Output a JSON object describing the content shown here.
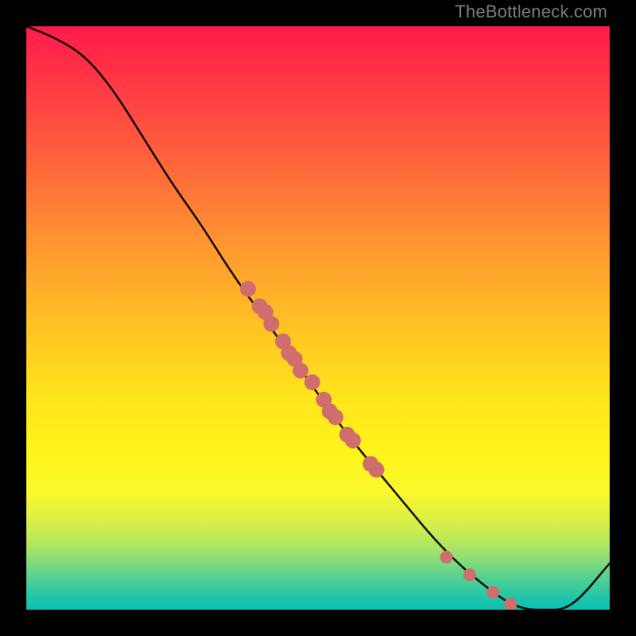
{
  "watermark": "TheBottleneck.com",
  "colors": {
    "dot": "#cf6e6c",
    "line": "#000000",
    "frame": "#000000"
  },
  "chart_data": {
    "type": "line",
    "title": "",
    "xlabel": "",
    "ylabel": "",
    "xlim": [
      0,
      100
    ],
    "ylim": [
      0,
      100
    ],
    "grid": false,
    "series": [
      {
        "name": "curve",
        "comment": "black curve; y is height above bottom (0=bottom,100=top)",
        "x": [
          0,
          5,
          10,
          15,
          20,
          25,
          30,
          35,
          40,
          45,
          50,
          55,
          60,
          65,
          70,
          75,
          80,
          83,
          86,
          89,
          92,
          95,
          100
        ],
        "y": [
          100,
          98,
          95,
          89,
          81,
          73,
          66,
          58,
          51,
          44,
          37,
          30,
          24,
          18,
          12,
          7,
          3,
          1,
          0,
          0,
          0,
          2,
          8
        ]
      }
    ],
    "scatter": {
      "name": "points-on-curve",
      "comment": "salmon dots lying on the curve",
      "x": [
        38,
        40,
        41,
        42,
        44,
        45,
        46,
        47,
        49,
        51,
        52,
        53,
        55,
        56,
        59,
        60,
        72,
        76,
        80,
        83
      ],
      "y": [
        55,
        52,
        51,
        49,
        46,
        44,
        43,
        41,
        39,
        36,
        34,
        33,
        30,
        29,
        25,
        24,
        9,
        6,
        3,
        1
      ]
    }
  }
}
